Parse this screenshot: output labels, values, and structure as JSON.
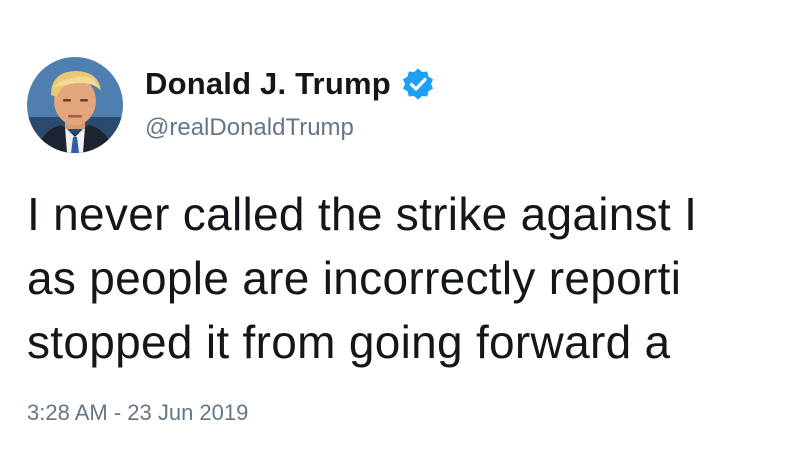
{
  "tweet": {
    "display_name": "Donald J. Trump",
    "handle": "@realDonaldTrump",
    "verified_icon": "verified-badge-icon",
    "avatar_icon": "profile-photo",
    "text_lines": [
      "I never called the strike against I",
      "as people are incorrectly reporti",
      "stopped it from going forward a"
    ],
    "timestamp": "3:28 AM - 23 Jun 2019"
  },
  "colors": {
    "text": "#14171a",
    "secondary_text": "#657786",
    "verified_blue": "#1da1f2",
    "background": "#ffffff"
  }
}
